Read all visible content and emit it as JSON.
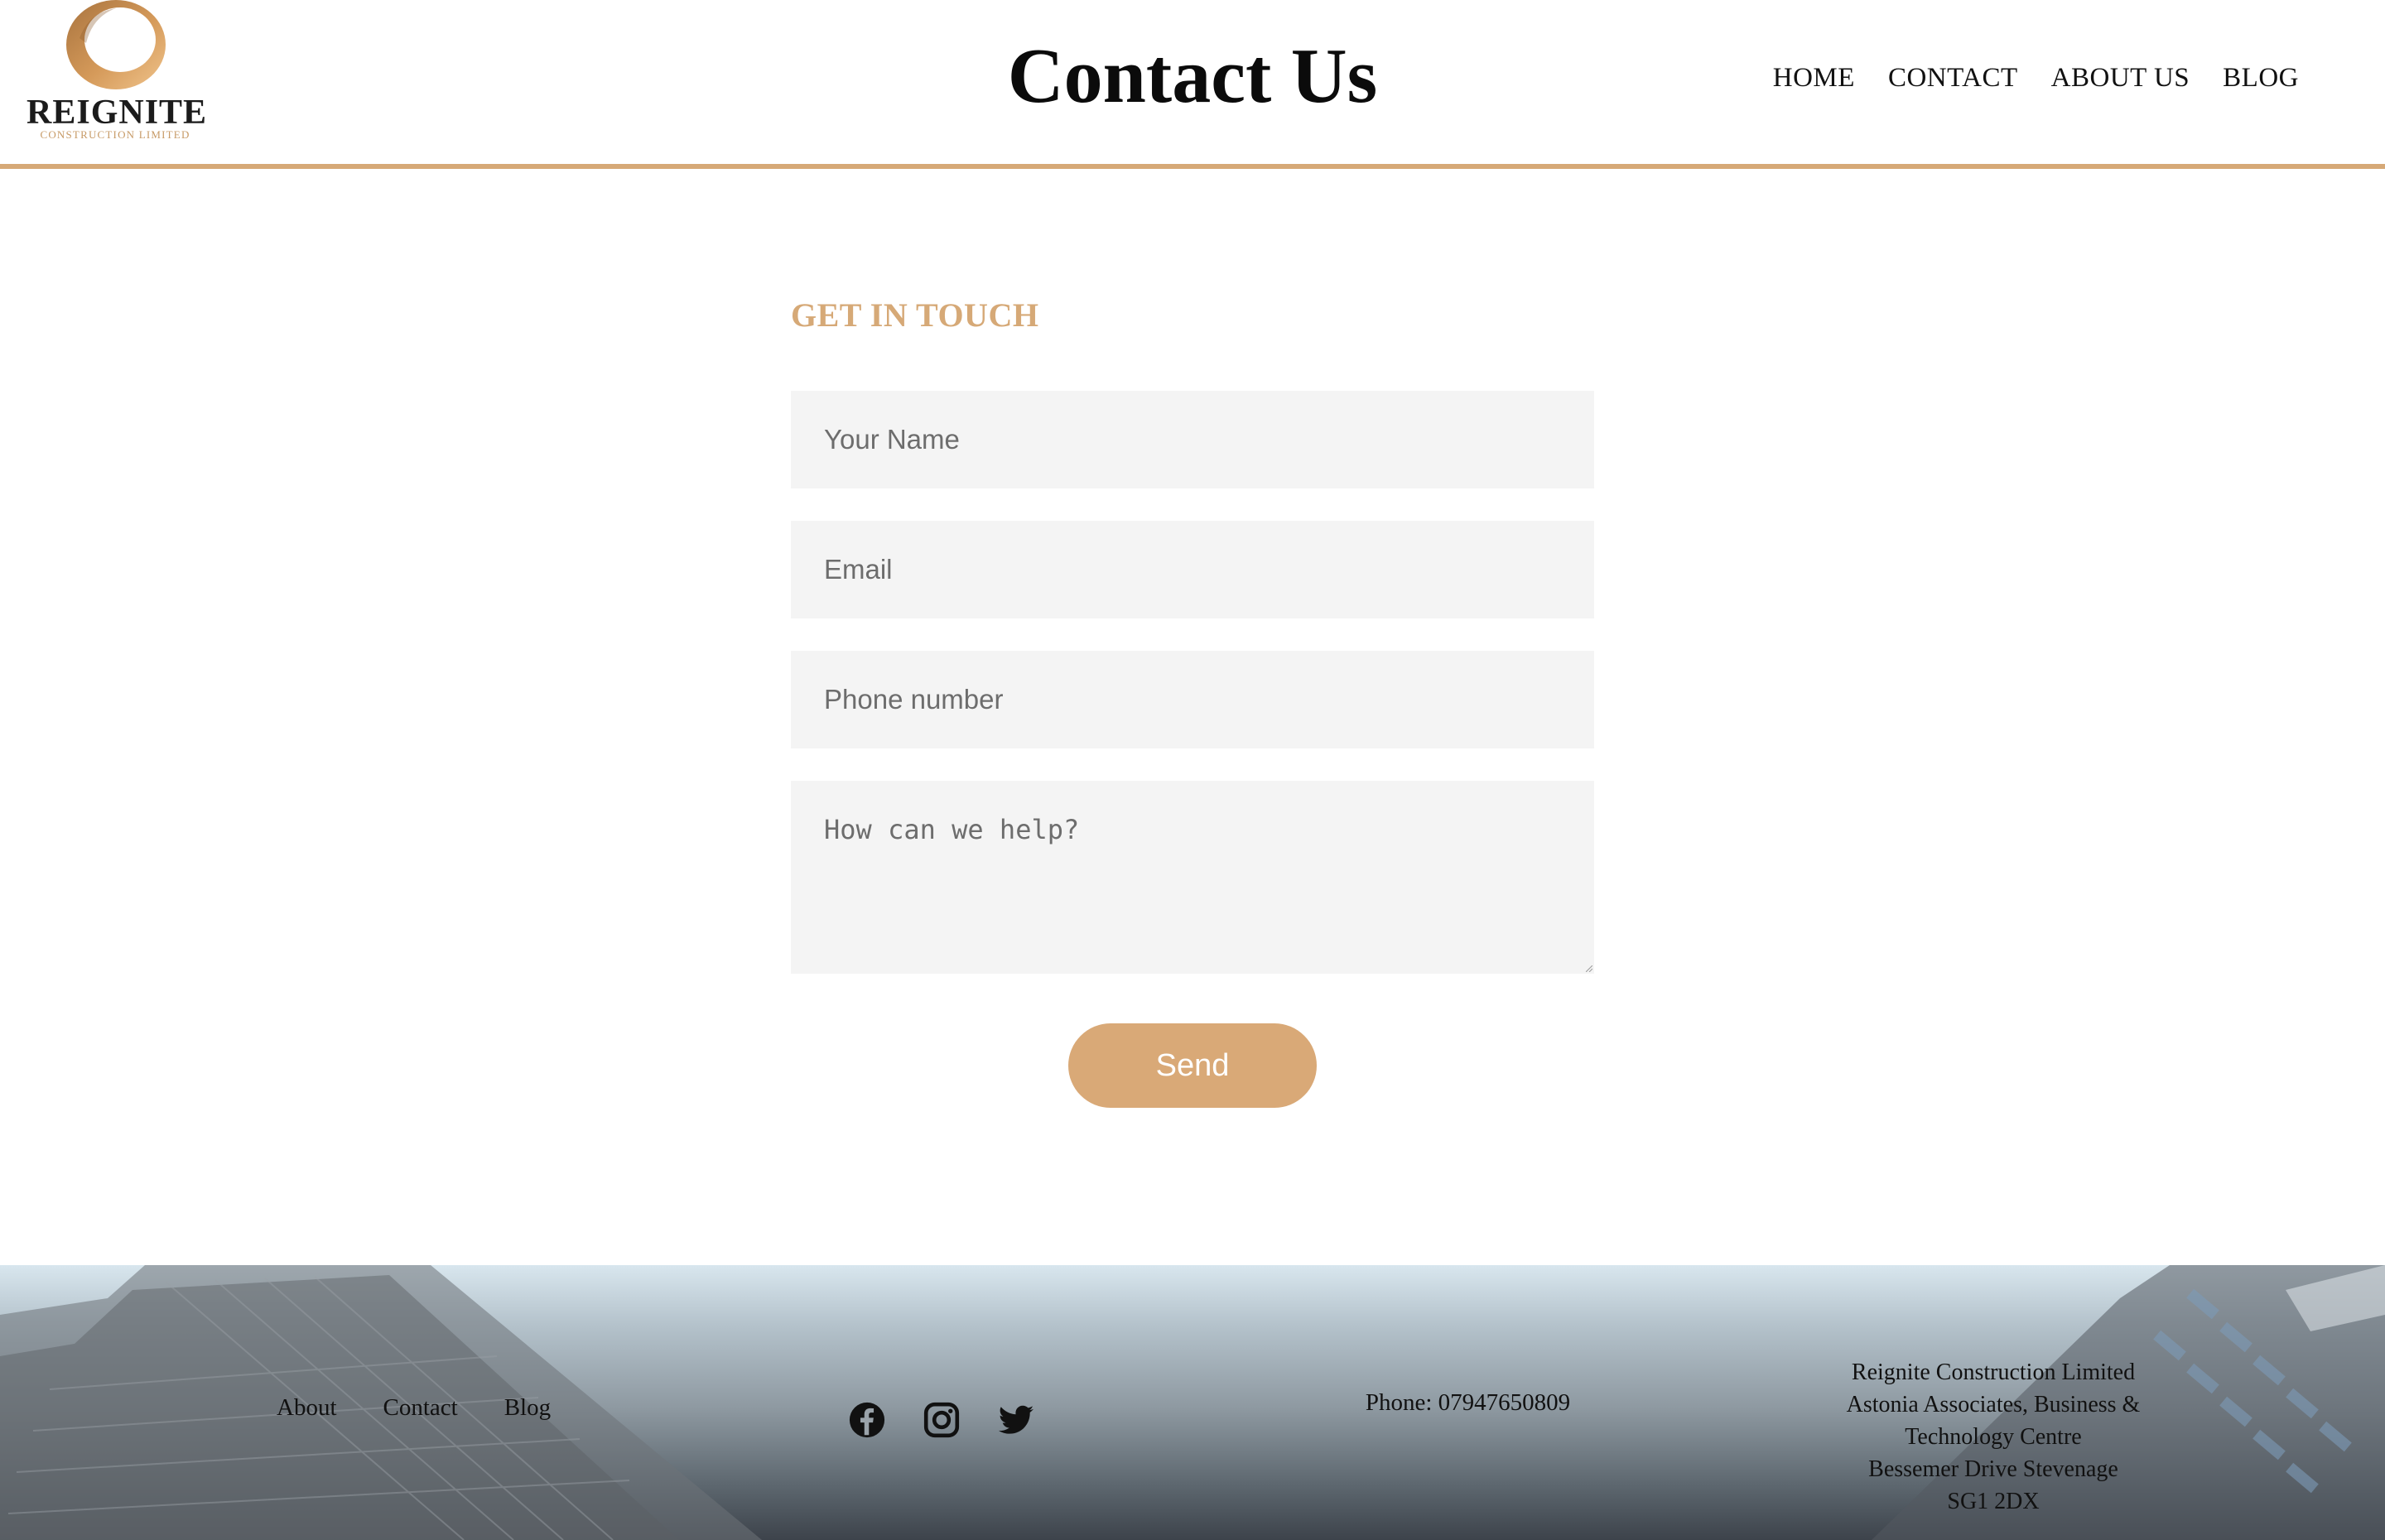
{
  "brand": {
    "name": "REIGNITE",
    "tagline": "CONSTRUCTION LIMITED",
    "accent_color": "#d6a977",
    "button_color": "#d9a977"
  },
  "header": {
    "title": "Contact Us",
    "nav": [
      "HOME",
      "CONTACT",
      "ABOUT US",
      "BLOG"
    ]
  },
  "form": {
    "heading": "GET IN TOUCH",
    "name_placeholder": "Your Name",
    "email_placeholder": "Email",
    "phone_placeholder": "Phone number",
    "message_placeholder": "How can we help?",
    "submit_label": "Send"
  },
  "footer": {
    "links": [
      "About",
      "Contact",
      "Blog"
    ],
    "social_icons": [
      "facebook-icon",
      "instagram-icon",
      "twitter-icon"
    ],
    "phone": "Phone: 07947650809",
    "address": [
      "Reignite Construction Limited",
      "Astonia Associates, Business &",
      "Technology Centre",
      "Bessemer Drive Stevenage",
      "SG1 2DX"
    ]
  }
}
